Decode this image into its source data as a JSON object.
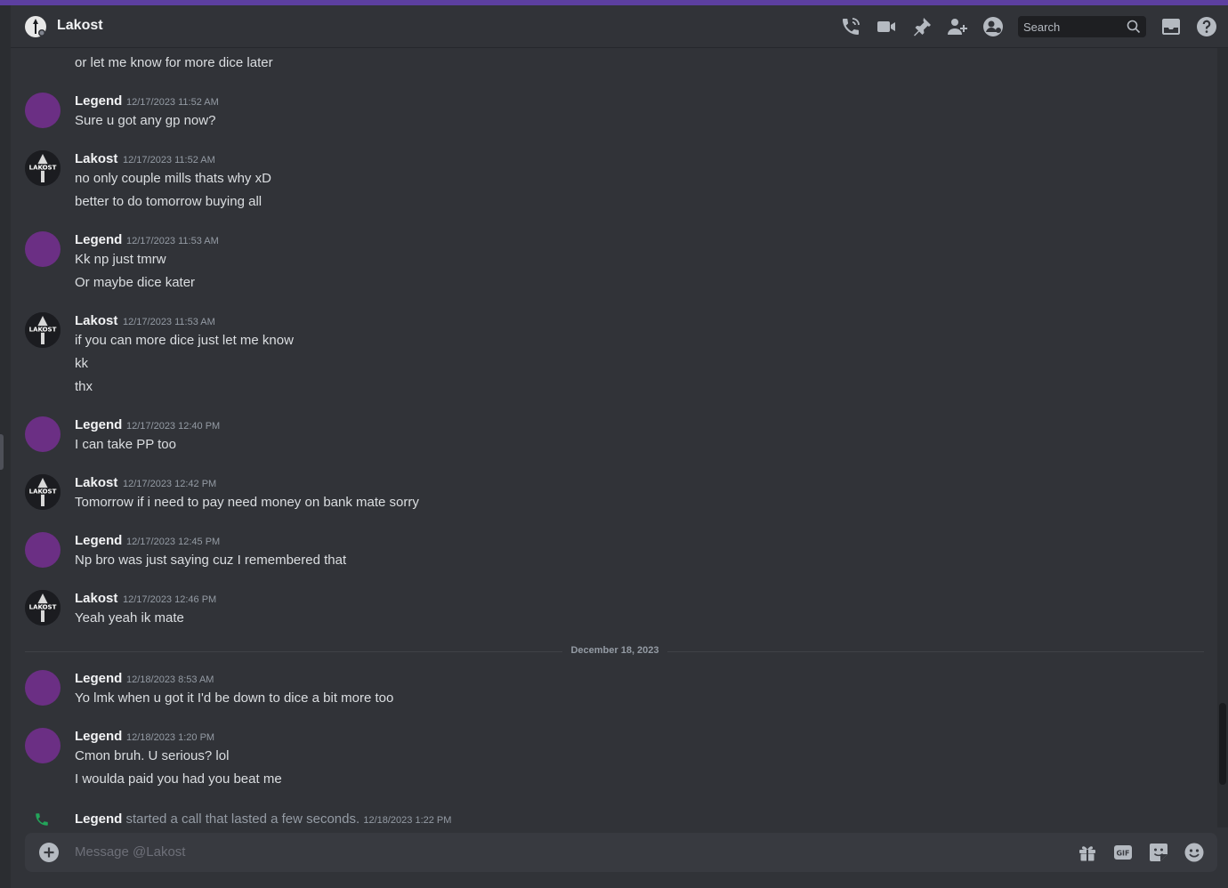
{
  "channel": {
    "title": "Lakost",
    "search_placeholder": "Search",
    "message_placeholder": "Message @Lakost"
  },
  "header_icons": [
    "call-icon",
    "video-call-icon",
    "pin-icon",
    "add-friend-icon",
    "user-profile-icon",
    "inbox-icon",
    "help-icon"
  ],
  "messages": {
    "m0": {
      "lines": [
        "or let me know for more dice later"
      ]
    },
    "m1": {
      "author": "Legend",
      "time": "12/17/2023 11:52 AM",
      "lines": [
        "Sure u got any gp now?"
      ]
    },
    "m2": {
      "author": "Lakost",
      "time": "12/17/2023 11:52 AM",
      "lines": [
        "no only couple mills thats why xD",
        "better to do tomorrow buying all"
      ]
    },
    "m3": {
      "author": "Legend",
      "time": "12/17/2023 11:53 AM",
      "lines": [
        "Kk np just tmrw",
        "Or maybe dice kater"
      ]
    },
    "m4": {
      "author": "Lakost",
      "time": "12/17/2023 11:53 AM",
      "lines": [
        "if you can more dice just let me know",
        "kk",
        "thx"
      ]
    },
    "m5": {
      "author": "Legend",
      "time": "12/17/2023 12:40 PM",
      "lines": [
        "I can take PP too"
      ]
    },
    "m6": {
      "author": "Lakost",
      "time": "12/17/2023 12:42 PM",
      "lines": [
        "Tomorrow if i need to pay need money on bank mate sorry"
      ]
    },
    "m7": {
      "author": "Legend",
      "time": "12/17/2023 12:45 PM",
      "lines": [
        "Np bro was just saying cuz I remembered that"
      ]
    },
    "m8": {
      "author": "Lakost",
      "time": "12/17/2023 12:46 PM",
      "lines": [
        "Yeah yeah ik mate"
      ]
    },
    "m9": {
      "author": "Legend",
      "time": "12/18/2023 8:53 AM",
      "lines": [
        "Yo lmk when u got it I'd be down to dice a bit more too"
      ]
    },
    "m10": {
      "author": "Legend",
      "time": "12/18/2023 1:20 PM",
      "lines": [
        "Cmon bruh. U serious? lol",
        "I woulda paid you had you beat me"
      ]
    }
  },
  "date_divider": "December 18, 2023",
  "call": {
    "author": "Legend",
    "text": "started a call that lasted a few seconds.",
    "time": "12/18/2023 1:22 PM"
  },
  "avatar_text": "LAKOST",
  "colors": {
    "accent_bar": "#5c3fa0",
    "legend_avatar": "#6b2f84",
    "call_icon": "#23a55a",
    "background": "#313338"
  }
}
